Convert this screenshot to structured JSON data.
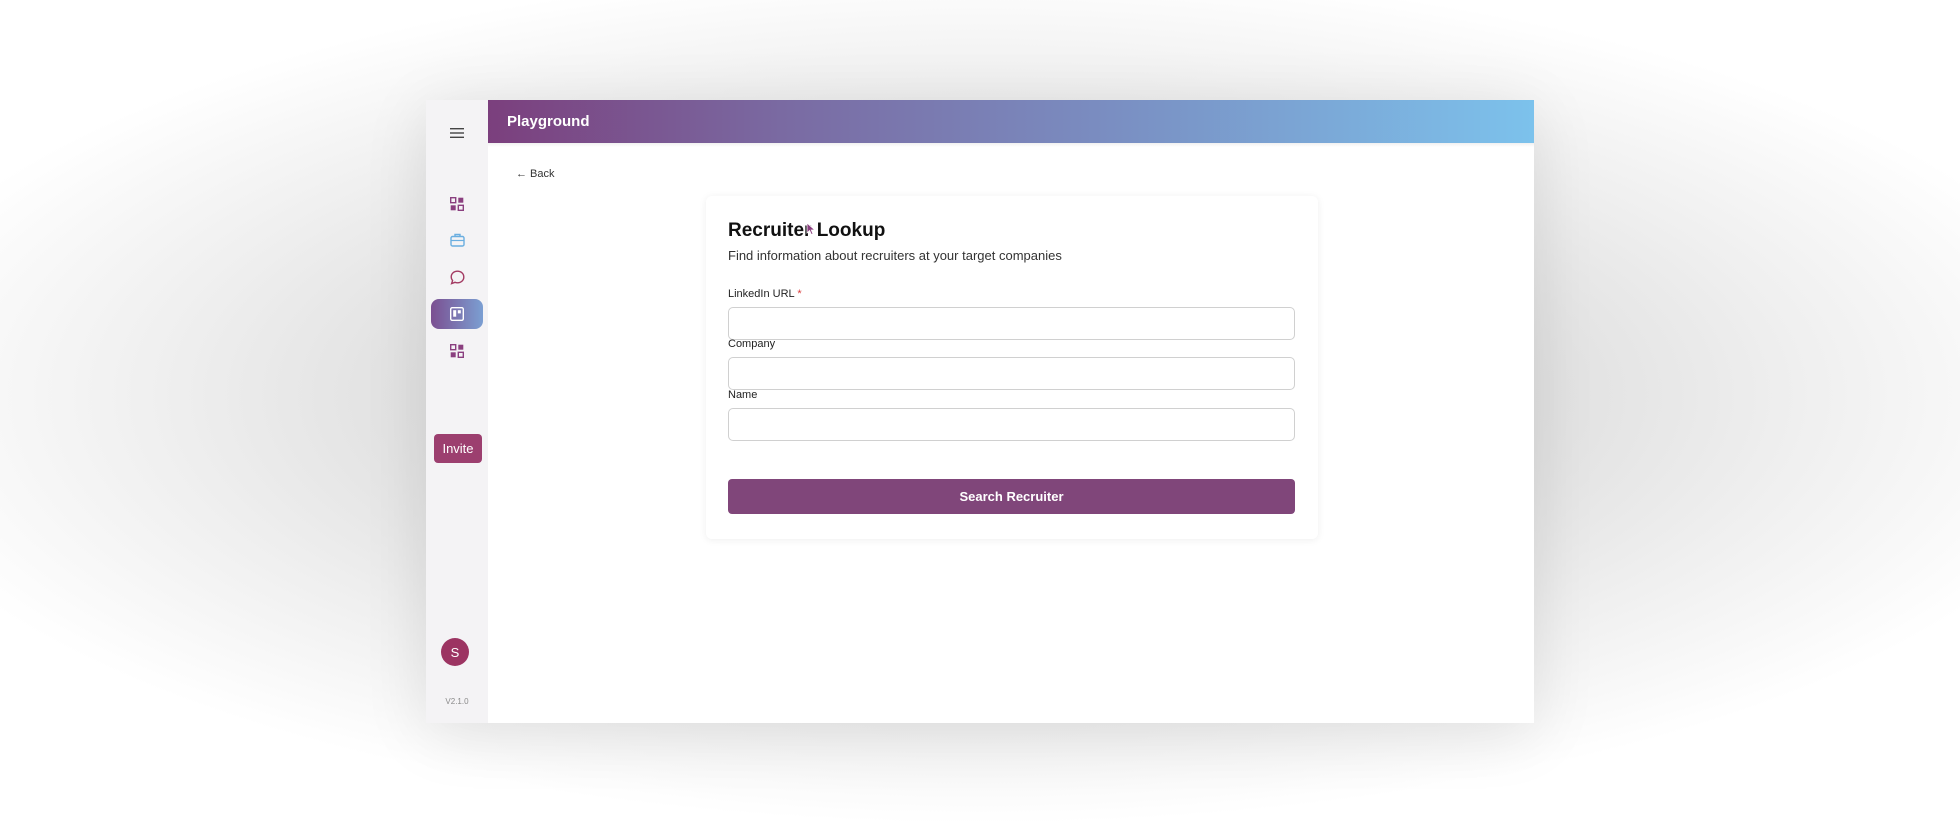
{
  "sidebar": {
    "icons": [
      "hamburger-menu-icon",
      "dashboard-grid-icon",
      "briefcase-icon",
      "chat-bubble-icon",
      "kanban-board-icon",
      "dashboard-grid-icon"
    ],
    "invite_label": "Invite",
    "avatar_initial": "S",
    "version": "V2.1.0"
  },
  "header": {
    "title": "Playground"
  },
  "back": {
    "arrow": "←",
    "label": "Back"
  },
  "form": {
    "title": "Recruiter Lookup",
    "subtitle": "Find information about recruiters at your target companies",
    "fields": [
      {
        "label": "LinkedIn URL",
        "required_mark": "*",
        "value": ""
      },
      {
        "label": "Company",
        "value": ""
      },
      {
        "label": "Name",
        "value": ""
      }
    ],
    "submit_label": "Search Recruiter"
  },
  "colors": {
    "brand_purple": "#80467a",
    "invite_pink": "#9c3f6f",
    "header_gradient_start": "#7b3f7d",
    "header_gradient_end": "#7cc2ec",
    "required_red": "#d93a3a"
  }
}
